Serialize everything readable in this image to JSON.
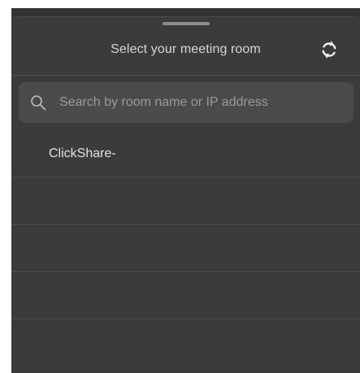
{
  "header": {
    "title": "Select your meeting room",
    "refresh_icon": "refresh-icon"
  },
  "search": {
    "placeholder": "Search by room name or IP address",
    "value": "",
    "icon": "search-icon"
  },
  "rooms": [
    {
      "label": "ClickShare-"
    },
    {
      "label": ""
    },
    {
      "label": ""
    },
    {
      "label": ""
    }
  ],
  "colors": {
    "sheet_background": "#3b3b3b",
    "search_background": "#4b4b4b",
    "text_primary": "#e2e2e2",
    "text_placeholder": "#9a9a9a",
    "divider": "#4c4c4c"
  }
}
